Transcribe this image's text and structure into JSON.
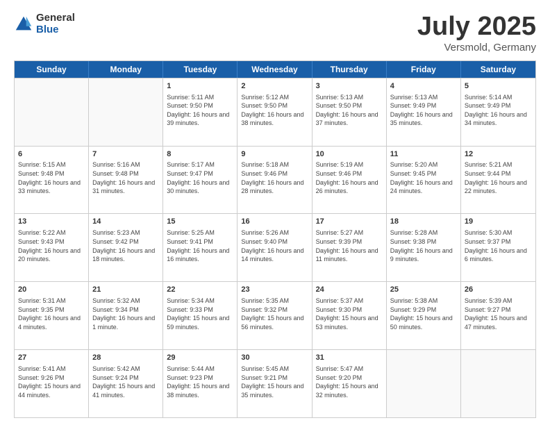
{
  "logo": {
    "general": "General",
    "blue": "Blue"
  },
  "title": "July 2025",
  "subtitle": "Versmold, Germany",
  "header_days": [
    "Sunday",
    "Monday",
    "Tuesday",
    "Wednesday",
    "Thursday",
    "Friday",
    "Saturday"
  ],
  "weeks": [
    [
      {
        "day": "",
        "info": ""
      },
      {
        "day": "",
        "info": ""
      },
      {
        "day": "1",
        "info": "Sunrise: 5:11 AM\nSunset: 9:50 PM\nDaylight: 16 hours and 39 minutes."
      },
      {
        "day": "2",
        "info": "Sunrise: 5:12 AM\nSunset: 9:50 PM\nDaylight: 16 hours and 38 minutes."
      },
      {
        "day": "3",
        "info": "Sunrise: 5:13 AM\nSunset: 9:50 PM\nDaylight: 16 hours and 37 minutes."
      },
      {
        "day": "4",
        "info": "Sunrise: 5:13 AM\nSunset: 9:49 PM\nDaylight: 16 hours and 35 minutes."
      },
      {
        "day": "5",
        "info": "Sunrise: 5:14 AM\nSunset: 9:49 PM\nDaylight: 16 hours and 34 minutes."
      }
    ],
    [
      {
        "day": "6",
        "info": "Sunrise: 5:15 AM\nSunset: 9:48 PM\nDaylight: 16 hours and 33 minutes."
      },
      {
        "day": "7",
        "info": "Sunrise: 5:16 AM\nSunset: 9:48 PM\nDaylight: 16 hours and 31 minutes."
      },
      {
        "day": "8",
        "info": "Sunrise: 5:17 AM\nSunset: 9:47 PM\nDaylight: 16 hours and 30 minutes."
      },
      {
        "day": "9",
        "info": "Sunrise: 5:18 AM\nSunset: 9:46 PM\nDaylight: 16 hours and 28 minutes."
      },
      {
        "day": "10",
        "info": "Sunrise: 5:19 AM\nSunset: 9:46 PM\nDaylight: 16 hours and 26 minutes."
      },
      {
        "day": "11",
        "info": "Sunrise: 5:20 AM\nSunset: 9:45 PM\nDaylight: 16 hours and 24 minutes."
      },
      {
        "day": "12",
        "info": "Sunrise: 5:21 AM\nSunset: 9:44 PM\nDaylight: 16 hours and 22 minutes."
      }
    ],
    [
      {
        "day": "13",
        "info": "Sunrise: 5:22 AM\nSunset: 9:43 PM\nDaylight: 16 hours and 20 minutes."
      },
      {
        "day": "14",
        "info": "Sunrise: 5:23 AM\nSunset: 9:42 PM\nDaylight: 16 hours and 18 minutes."
      },
      {
        "day": "15",
        "info": "Sunrise: 5:25 AM\nSunset: 9:41 PM\nDaylight: 16 hours and 16 minutes."
      },
      {
        "day": "16",
        "info": "Sunrise: 5:26 AM\nSunset: 9:40 PM\nDaylight: 16 hours and 14 minutes."
      },
      {
        "day": "17",
        "info": "Sunrise: 5:27 AM\nSunset: 9:39 PM\nDaylight: 16 hours and 11 minutes."
      },
      {
        "day": "18",
        "info": "Sunrise: 5:28 AM\nSunset: 9:38 PM\nDaylight: 16 hours and 9 minutes."
      },
      {
        "day": "19",
        "info": "Sunrise: 5:30 AM\nSunset: 9:37 PM\nDaylight: 16 hours and 6 minutes."
      }
    ],
    [
      {
        "day": "20",
        "info": "Sunrise: 5:31 AM\nSunset: 9:35 PM\nDaylight: 16 hours and 4 minutes."
      },
      {
        "day": "21",
        "info": "Sunrise: 5:32 AM\nSunset: 9:34 PM\nDaylight: 16 hours and 1 minute."
      },
      {
        "day": "22",
        "info": "Sunrise: 5:34 AM\nSunset: 9:33 PM\nDaylight: 15 hours and 59 minutes."
      },
      {
        "day": "23",
        "info": "Sunrise: 5:35 AM\nSunset: 9:32 PM\nDaylight: 15 hours and 56 minutes."
      },
      {
        "day": "24",
        "info": "Sunrise: 5:37 AM\nSunset: 9:30 PM\nDaylight: 15 hours and 53 minutes."
      },
      {
        "day": "25",
        "info": "Sunrise: 5:38 AM\nSunset: 9:29 PM\nDaylight: 15 hours and 50 minutes."
      },
      {
        "day": "26",
        "info": "Sunrise: 5:39 AM\nSunset: 9:27 PM\nDaylight: 15 hours and 47 minutes."
      }
    ],
    [
      {
        "day": "27",
        "info": "Sunrise: 5:41 AM\nSunset: 9:26 PM\nDaylight: 15 hours and 44 minutes."
      },
      {
        "day": "28",
        "info": "Sunrise: 5:42 AM\nSunset: 9:24 PM\nDaylight: 15 hours and 41 minutes."
      },
      {
        "day": "29",
        "info": "Sunrise: 5:44 AM\nSunset: 9:23 PM\nDaylight: 15 hours and 38 minutes."
      },
      {
        "day": "30",
        "info": "Sunrise: 5:45 AM\nSunset: 9:21 PM\nDaylight: 15 hours and 35 minutes."
      },
      {
        "day": "31",
        "info": "Sunrise: 5:47 AM\nSunset: 9:20 PM\nDaylight: 15 hours and 32 minutes."
      },
      {
        "day": "",
        "info": ""
      },
      {
        "day": "",
        "info": ""
      }
    ]
  ]
}
